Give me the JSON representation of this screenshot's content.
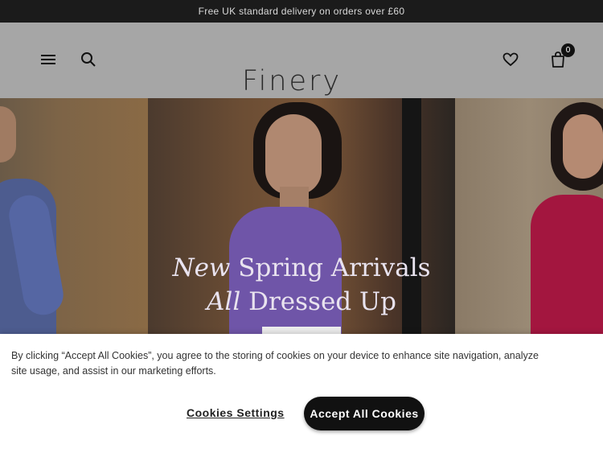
{
  "promo": {
    "text": "Free UK standard delivery on orders over £60"
  },
  "header": {
    "logo": "Finery",
    "bag_count": "0",
    "icons": {
      "menu": "hamburger-menu-icon",
      "search": "search-icon",
      "wishlist": "heart-icon",
      "bag": "shopping-bag-icon"
    }
  },
  "hero": {
    "line1_italic": "New",
    "line1_rest": " Spring Arrivals",
    "line2_italic": "All",
    "line2_rest": " Dressed Up"
  },
  "cookie_banner": {
    "text": "By clicking “Accept All Cookies”, you agree to the storing of cookies on your device to enhance site navigation, analyze site usage, and assist in our marketing efforts.",
    "settings_label": "Cookies Settings",
    "accept_label": "Accept All Cookies"
  },
  "colors": {
    "promo_bg": "#1b1b1b",
    "header_bg": "#a6a6a6",
    "accept_bg": "#111111"
  }
}
